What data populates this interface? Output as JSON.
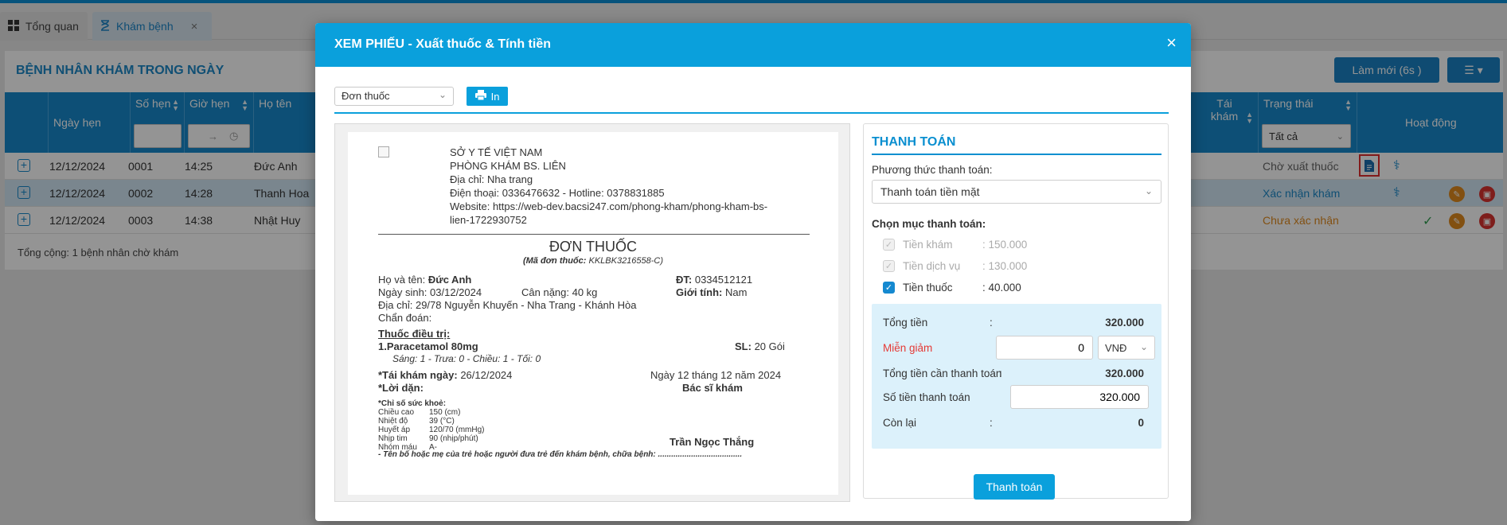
{
  "tabs": [
    {
      "label": "Tổng quan",
      "icon": "dashboard-icon"
    },
    {
      "label": "Khám bệnh",
      "icon": "hourglass-icon"
    }
  ],
  "list": {
    "title": "BỆNH NHÂN KHÁM TRONG NGÀY",
    "refresh_label": "Làm mới (6s )",
    "columns": {
      "date": "Ngày hẹn",
      "number": "Số hẹn",
      "time": "Giờ hẹn",
      "name": "Họ tên",
      "revisit": "Tái khám",
      "status": "Trạng thái",
      "actions": "Hoạt động"
    },
    "status_filter": "Tất cả",
    "rows": [
      {
        "date": "12/12/2024",
        "number": "0001",
        "time": "14:25",
        "name": "Đức Anh",
        "status": "Chờ xuất thuốc"
      },
      {
        "date": "12/12/2024",
        "number": "0002",
        "time": "14:28",
        "name": "Thanh Hoa",
        "status": "Xác nhận khám"
      },
      {
        "date": "12/12/2024",
        "number": "0003",
        "time": "14:38",
        "name": "Nhật Huy",
        "status": "Chưa xác nhận"
      }
    ],
    "total_note": "Tổng cộng: 1 bệnh nhân chờ khám"
  },
  "modal": {
    "title": "XEM PHIẾU - Xuất thuốc & Tính tiền",
    "doc_type": "Đơn thuốc",
    "print_label": "In"
  },
  "receipt": {
    "org": "SỞ Y TẾ VIỆT NAM",
    "clinic": "PHÒNG KHÁM BS. LIÊN",
    "address": "Địa chỉ: Nha trang",
    "phone": "Điện thoại: 0336476632 - Hotline: 0378831885",
    "website1": "Website: https://web-dev.bacsi247.com/phong-kham/phong-kham-bs-",
    "website2": "lien-1722930752",
    "doc_title": "ĐƠN THUỐC",
    "doc_code_label": "(Mã đơn thuốc:",
    "doc_code": "KKLBK3216558-C)",
    "name_label": "Họ và tên:",
    "name": "Đức Anh",
    "phone_label": "ĐT:",
    "phone_value": "0334512121",
    "dob": "Ngày sinh: 03/12/2024",
    "weight": "Cân nặng: 40 kg",
    "gender_label": "Giới tính:",
    "gender": "Nam",
    "patient_address": "Địa chỉ: 29/78 Nguyễn Khuyến - Nha Trang - Khánh Hòa",
    "diagnosis": "Chẩn đoán:",
    "treatment_label": "Thuốc điều trị:",
    "drug": "1.Paracetamol 80mg",
    "qty_label": "SL:",
    "qty": "20 Gói",
    "dosage": "Sáng: 1 - Trưa: 0 - Chiều: 1 - Tối: 0",
    "revisit_label": "*Tái khám ngày:",
    "revisit_date": "26/12/2024",
    "date_line": "Ngày 12 tháng 12 năm 2024",
    "advice_label": "*Lời dặn:",
    "doctor_label": "Bác sĩ khám",
    "vitals_title": "*Chỉ số sức khoẻ:",
    "vitals": [
      {
        "k": "Chiều cao",
        "v": "150 (cm)"
      },
      {
        "k": "Nhiệt độ",
        "v": "39 (°C)"
      },
      {
        "k": "Huyết áp",
        "v": "120/70 (mmHg)"
      },
      {
        "k": "Nhịp tim",
        "v": "90 (nhịp/phút)"
      },
      {
        "k": "Nhóm máu",
        "v": "A-"
      }
    ],
    "doctor_name": "Trần Ngọc Thắng",
    "guardian_note": "- Tên bố hoặc mẹ của trẻ hoặc người đưa trẻ đến khám bệnh, chữa bệnh: ......................................"
  },
  "payment": {
    "title": "THANH TOÁN",
    "method_label": "Phương thức thanh toán:",
    "method": "Thanh toán tiền mặt",
    "items_label": "Chọn mục thanh toán:",
    "items": [
      {
        "name": "Tiền khám",
        "amount": ": 150.000",
        "checked": true,
        "disabled": true
      },
      {
        "name": "Tiền dịch vụ",
        "amount": ": 130.000",
        "checked": true,
        "disabled": true
      },
      {
        "name": "Tiền thuốc",
        "amount": ": 40.000",
        "checked": true,
        "disabled": false
      }
    ],
    "total_label": "Tổng tiền",
    "total": "320.000",
    "discount_label": "Miễn giảm",
    "discount": "0",
    "currency": "VNĐ",
    "due_label": "Tổng tiền cần thanh toán",
    "due": "320.000",
    "paid_label": "Số tiền thanh toán",
    "paid": "320.000",
    "remaining_label": "Còn lại",
    "remaining": "0",
    "pay_button": "Thanh toán"
  },
  "colors": {
    "accent": "#0aa0dc",
    "header_blue": "#1789cb",
    "status_waiting": "#666666",
    "status_confirmed": "#1d89c8",
    "status_unconfirmed": "#e08a1e",
    "discount_label": "#e53935"
  }
}
